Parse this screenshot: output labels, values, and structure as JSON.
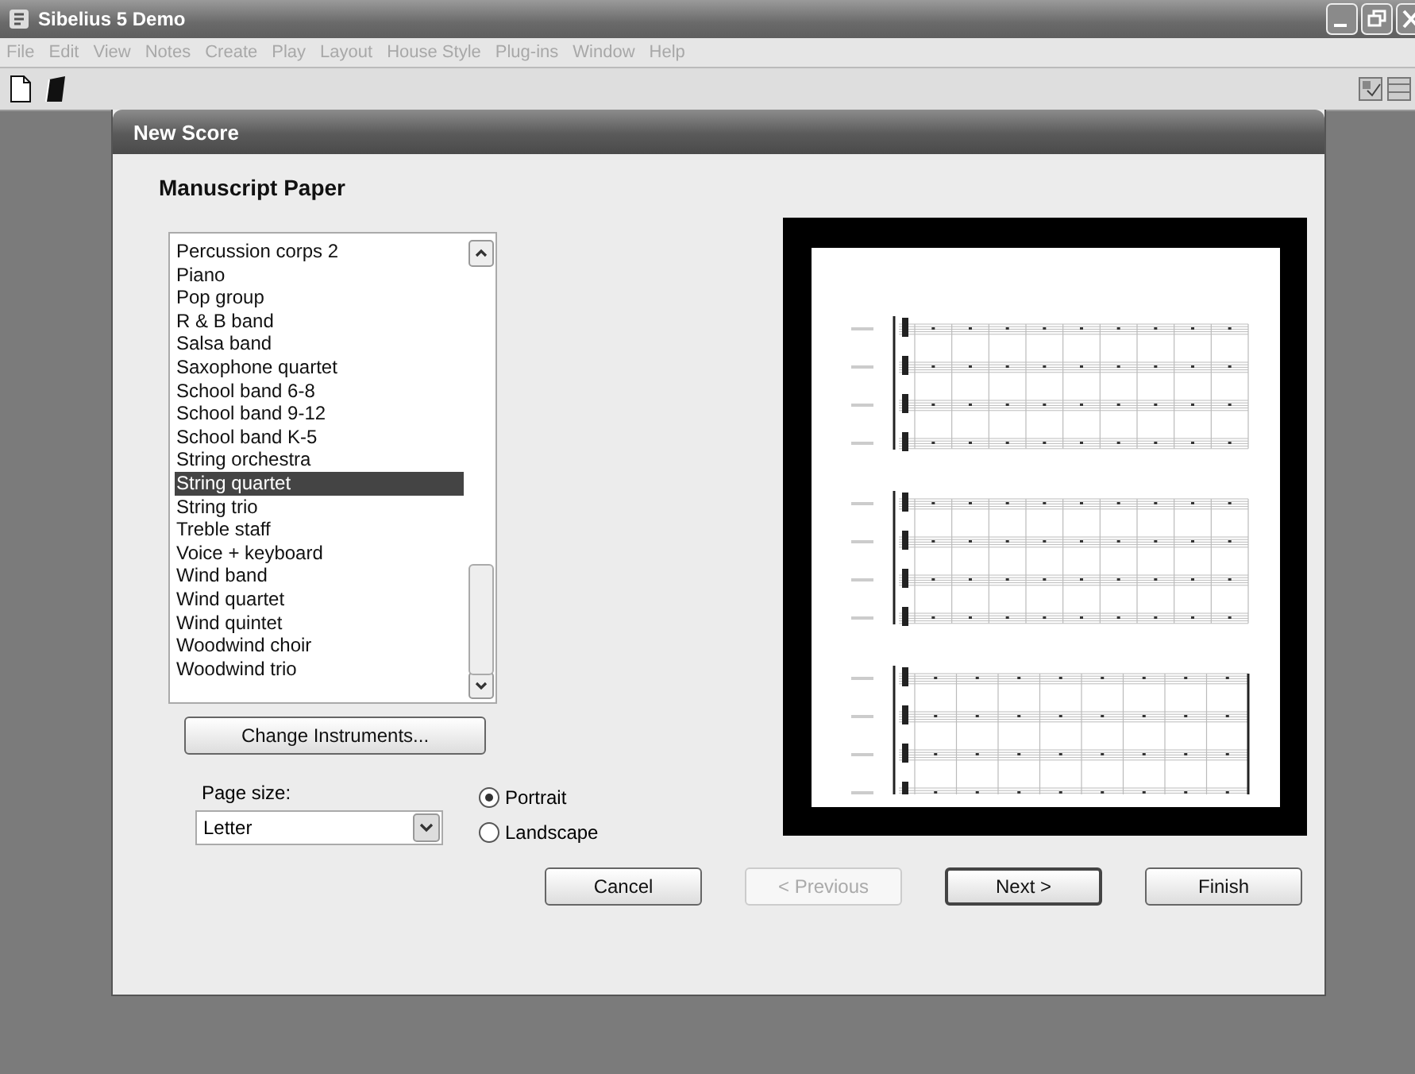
{
  "window": {
    "title": "Sibelius 5 Demo"
  },
  "menu": [
    {
      "label": "File",
      "disabled": true
    },
    {
      "label": "Edit",
      "disabled": true
    },
    {
      "label": "View",
      "disabled": true
    },
    {
      "label": "Notes",
      "disabled": true
    },
    {
      "label": "Create",
      "disabled": true
    },
    {
      "label": "Play",
      "disabled": true
    },
    {
      "label": "Layout",
      "disabled": true
    },
    {
      "label": "House Style",
      "disabled": true
    },
    {
      "label": "Plug-ins",
      "disabled": true
    },
    {
      "label": "Window",
      "disabled": true
    },
    {
      "label": "Help",
      "disabled": true
    }
  ],
  "dialog": {
    "title": "New Score",
    "heading": "Manuscript Paper",
    "list": [
      {
        "label": "Percussion corps 2",
        "selected": false
      },
      {
        "label": "Piano",
        "selected": false
      },
      {
        "label": "Pop group",
        "selected": false
      },
      {
        "label": "R & B band",
        "selected": false
      },
      {
        "label": "Salsa band",
        "selected": false
      },
      {
        "label": "Saxophone quartet",
        "selected": false
      },
      {
        "label": "School band 6-8",
        "selected": false
      },
      {
        "label": "School band 9-12",
        "selected": false
      },
      {
        "label": "School band K-5",
        "selected": false
      },
      {
        "label": "String orchestra",
        "selected": false
      },
      {
        "label": "String quartet",
        "selected": true
      },
      {
        "label": "String trio",
        "selected": false
      },
      {
        "label": "Treble staff",
        "selected": false
      },
      {
        "label": "Voice + keyboard",
        "selected": false
      },
      {
        "label": "Wind band",
        "selected": false
      },
      {
        "label": "Wind quartet",
        "selected": false
      },
      {
        "label": "Wind quintet",
        "selected": false
      },
      {
        "label": "Woodwind choir",
        "selected": false
      },
      {
        "label": "Woodwind trio",
        "selected": false
      }
    ],
    "change_button": "Change Instruments...",
    "page_size": {
      "label": "Page size:",
      "value": "Letter"
    },
    "orientation": [
      {
        "label": "Portrait",
        "selected": true
      },
      {
        "label": "Landscape",
        "selected": false
      }
    ],
    "buttons": [
      {
        "label": "Cancel",
        "disabled": false,
        "default": false
      },
      {
        "label": "< Previous",
        "disabled": true,
        "default": false
      },
      {
        "label": "Next >",
        "disabled": false,
        "default": true
      },
      {
        "label": "Finish",
        "disabled": false,
        "default": false
      }
    ]
  }
}
